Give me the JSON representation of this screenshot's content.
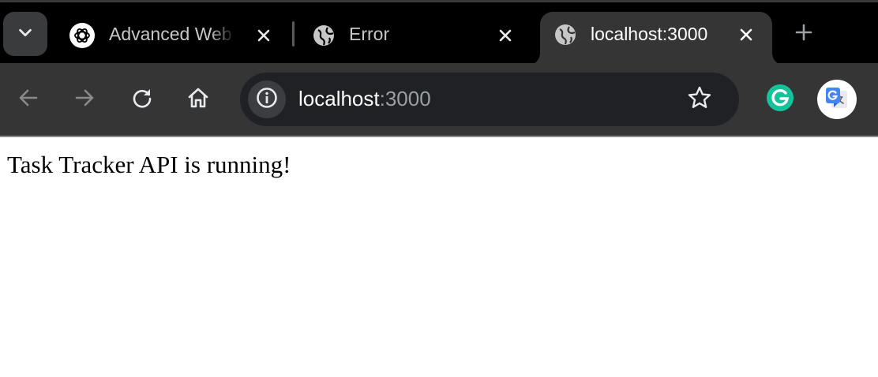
{
  "tabs": [
    {
      "title": "Advanced Web",
      "favicon": "openai-icon",
      "active": false
    },
    {
      "title": "Error",
      "favicon": "globe-icon",
      "active": false
    },
    {
      "title": "localhost:3000",
      "favicon": "globe-icon",
      "active": true
    }
  ],
  "omnibox": {
    "host": "localhost",
    "port": ":3000"
  },
  "extensions": [
    {
      "name": "grammarly-extension-icon",
      "color": "#15c39a"
    },
    {
      "name": "google-translate-extension-icon",
      "color": "#4285f4"
    }
  ],
  "page": {
    "body_text": "Task Tracker API is running!"
  },
  "colors": {
    "tabstrip_bg": "#000000",
    "toolbar_bg": "#353535",
    "omnibox_bg": "#202124"
  }
}
